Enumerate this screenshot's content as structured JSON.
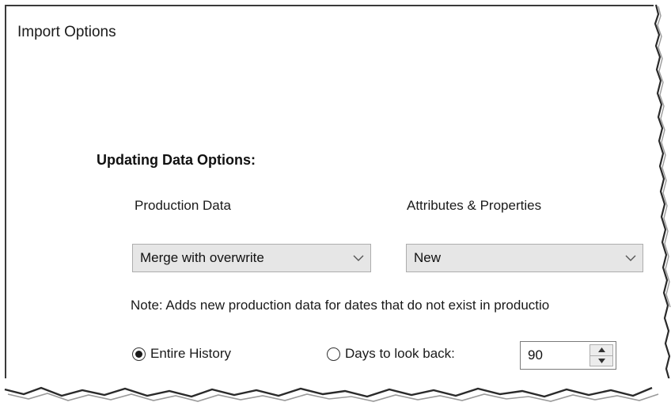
{
  "window": {
    "title": "Import Options"
  },
  "updating": {
    "heading": "Updating Data Options:",
    "production_label": "Production Data",
    "attributes_label": "Attributes & Properties",
    "production_select": {
      "value": "Merge with overwrite",
      "icon": "chevron-down-icon"
    },
    "attributes_select": {
      "value": "New",
      "icon": "chevron-down-icon"
    },
    "note": "Note: Adds new production data for dates that do not exist in productio"
  },
  "history": {
    "entire_label": "Entire History",
    "entire_selected": true,
    "days_label": "Days to look back:",
    "days_selected": false,
    "days_value": "90",
    "spinner_up_icon": "triangle-up-icon",
    "spinner_down_icon": "triangle-down-icon"
  }
}
